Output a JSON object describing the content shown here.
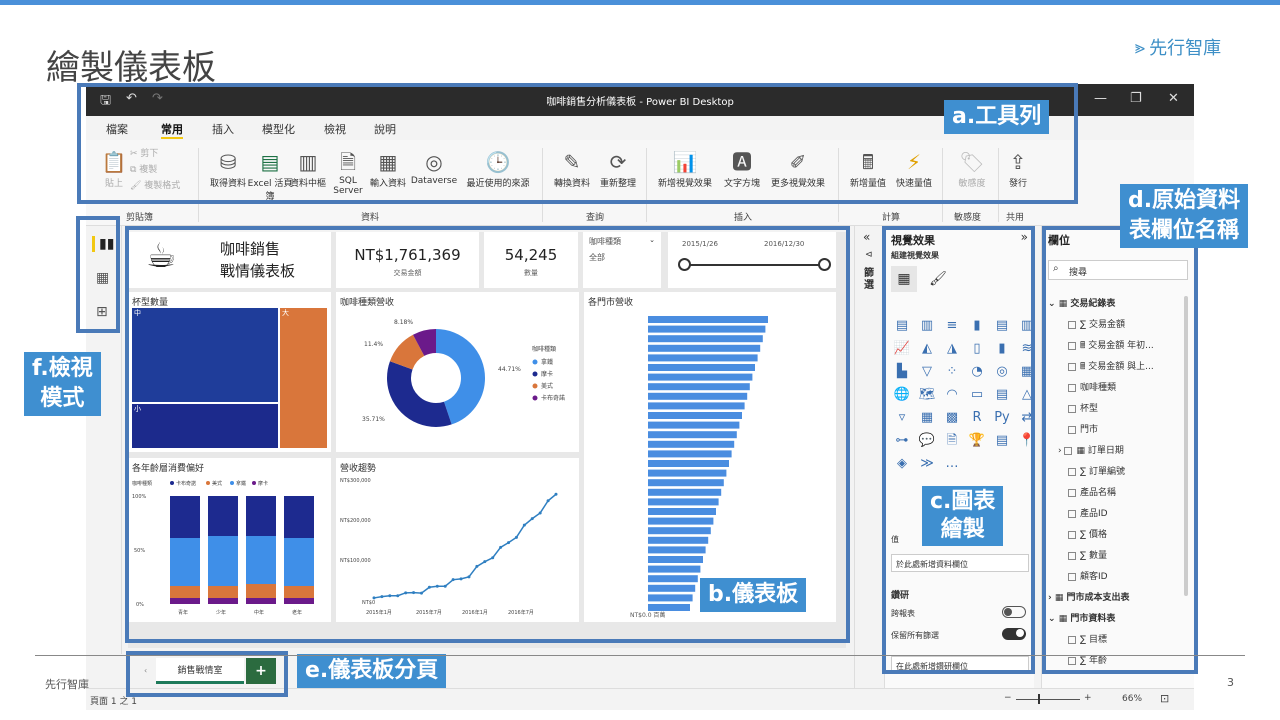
{
  "slide": {
    "title": "繪製儀表板",
    "logo": "先行智庫",
    "footer_left": "先行智庫",
    "page": "3"
  },
  "window": {
    "title": "咖啡銷售分析儀表板 - Power BI Desktop"
  },
  "menu": [
    "檔案",
    "常用",
    "插入",
    "模型化",
    "檢視",
    "說明"
  ],
  "ribbon": {
    "buttons": [
      "貼上",
      "剪下",
      "複製",
      "複製格式",
      "取得資料",
      "Excel 活頁簿",
      "資料中樞",
      "SQL Server",
      "輸入資料",
      "Dataverse",
      "最近使用的來源",
      "轉換資料",
      "重新整理",
      "新增視覺效果",
      "文字方塊",
      "更多視覺效果",
      "新增量值",
      "快速量值",
      "敏感度",
      "發行"
    ],
    "groups": [
      "剪貼簿",
      "資料",
      "查詢",
      "插入",
      "計算",
      "敏感度",
      "共用"
    ]
  },
  "dashboard": {
    "title_line1": "咖啡銷售",
    "title_line2": "戰情儀表板",
    "kpi1_value": "NT$1,761,369",
    "kpi1_label": "交易金額",
    "kpi2_value": "54,245",
    "kpi2_label": "數量",
    "slicer_label": "咖啡種類",
    "slicer_value": "全部",
    "date_from": "2015/1/26",
    "date_to": "2016/12/30",
    "treemap_title": "杯型數量",
    "treemap_labels": [
      "中",
      "大",
      "小"
    ],
    "donut_title": "咖啡種類營收",
    "donut_legend_title": "咖啡種類",
    "donut_legend": [
      "拿鐵",
      "摩卡",
      "美式",
      "卡布奇諾"
    ],
    "donut_values": [
      "44.71%",
      "35.71%",
      "11.4%",
      "8.18%"
    ],
    "stack_title": "各年齡層消費偏好",
    "stack_legend_title": "咖啡種類",
    "stack_legend": [
      "卡布奇諾",
      "美式",
      "拿鐵",
      "摩卡"
    ],
    "stack_x": [
      "青年",
      "少年",
      "中年",
      "老年"
    ],
    "stack_y": [
      "100%",
      "50%",
      "0%"
    ],
    "line_title": "營收趨勢",
    "line_y": [
      "NT$300,000",
      "NT$200,000",
      "NT$100,000",
      "NT$0"
    ],
    "line_x": [
      "2015年1月",
      "2015年7月",
      "2016年1月",
      "2016年7月"
    ],
    "bar_title": "各門市營收",
    "bar_x0": "NT$0.0 百萬"
  },
  "vis_pane": {
    "title": "視覺效果",
    "sub": "組建視覺效果",
    "values": "值",
    "add_field": "於此處新增資料欄位",
    "drill": "鑽研",
    "cross": "跨報表",
    "keep": "保留所有篩選",
    "add_drill": "在此處新增鑽研欄位"
  },
  "filter_label": "篩選",
  "fields": {
    "title": "欄位",
    "search": "搜尋",
    "items": [
      "交易紀錄表",
      "交易金額",
      "交易金額 年初...",
      "交易金額 與上...",
      "咖啡種類",
      "杯型",
      "門市",
      "訂單日期",
      "訂單編號",
      "產品名稱",
      "產品ID",
      "價格",
      "數量",
      "顧客ID",
      "門市成本支出表",
      "門市資料表",
      "目標",
      "年齡"
    ]
  },
  "tab": {
    "name": "銷售戰情室",
    "add": "+"
  },
  "status": {
    "page": "頁面 1 之 1",
    "zoom": "66%"
  },
  "annotations": {
    "a": "a.工具列",
    "b": "b.儀表板",
    "c": "c.圖表\n繪製",
    "d": "d.原始資料\n表欄位名稱",
    "e": "e.儀表板分頁",
    "f": "f.檢視\n模式"
  },
  "chart_data": [
    {
      "type": "pie",
      "title": "咖啡種類營收",
      "categories": [
        "拿鐵",
        "摩卡",
        "美式",
        "卡布奇諾"
      ],
      "values": [
        44.71,
        35.71,
        11.4,
        8.18
      ]
    },
    {
      "type": "line",
      "title": "營收趨勢",
      "x": [
        "2015年1月",
        "2015年7月",
        "2016年1月",
        "2016年7月",
        "2016年12月"
      ],
      "values": [
        10000,
        25000,
        60000,
        150000,
        265000
      ],
      "ylim": [
        0,
        300000
      ]
    },
    {
      "type": "bar",
      "title": "杯型數量",
      "categories": [
        "中",
        "大",
        "小"
      ],
      "values": [
        25000,
        8000,
        21000
      ]
    }
  ]
}
